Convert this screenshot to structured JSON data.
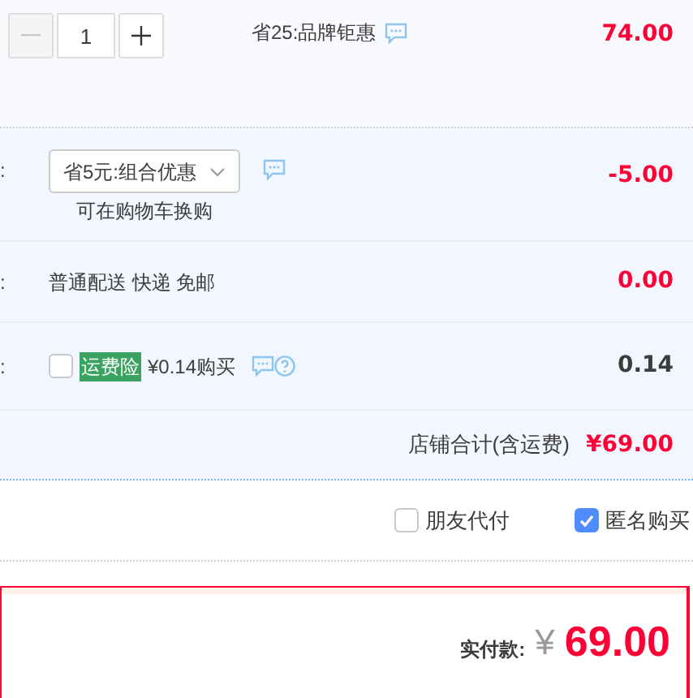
{
  "item": {
    "quantity": "1",
    "minus_disabled": true,
    "promo": "省25:品牌钜惠",
    "price": "74.00"
  },
  "promotion": {
    "label": ":",
    "selected": "省5元:组合优惠",
    "hint": "可在购物车换购",
    "amount": "-5.00"
  },
  "delivery": {
    "label": ":",
    "method": "普通配送 快递 免邮",
    "amount": "0.00"
  },
  "insurance": {
    "label": ":",
    "checked": false,
    "badge": "运费险",
    "offer": "¥0.14购买",
    "amount": "0.14"
  },
  "shop_total": {
    "label": "店铺合计(含运费)",
    "amount": "¥69.00"
  },
  "options": [
    {
      "label": "朋友代付",
      "checked": false
    },
    {
      "label": "匿名购买",
      "checked": true
    }
  ],
  "payment": {
    "label": "实付款:",
    "currency": "¥",
    "amount": "69.00"
  }
}
